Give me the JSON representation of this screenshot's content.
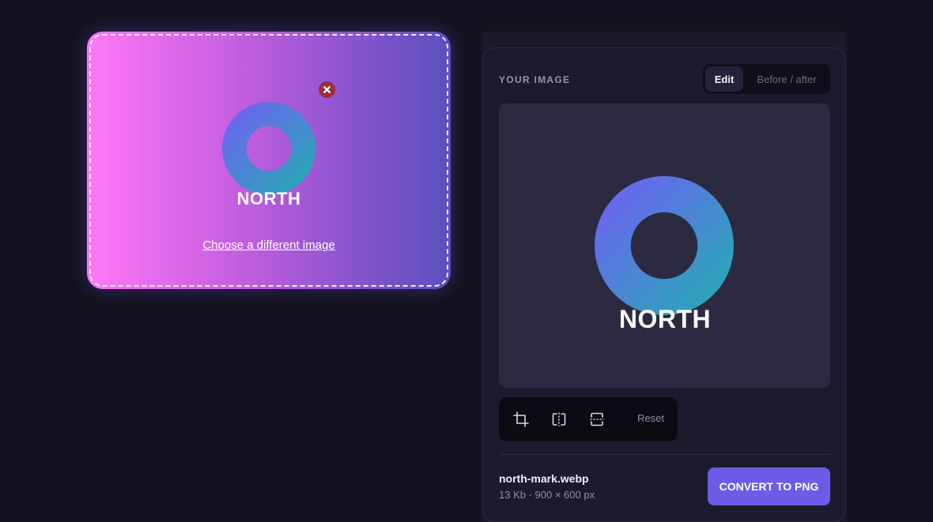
{
  "theme": {
    "accent": "#6c5ce7",
    "background": "#14131f",
    "remove_color": "#9b2f3a"
  },
  "dropzone": {
    "logo_text": "NORTH",
    "choose_link": "Choose a different image",
    "remove_icon": "close-icon"
  },
  "panel": {
    "title": "YOUR IMAGE",
    "tabs": [
      {
        "label": "Edit",
        "active": true
      },
      {
        "label": "Before / after",
        "active": false
      }
    ],
    "preview": {
      "logo_text": "NORTH"
    },
    "tools": [
      {
        "icon": "crop-icon"
      },
      {
        "icon": "flip-horizontal-icon"
      },
      {
        "icon": "flip-vertical-icon"
      }
    ],
    "reset_label": "Reset",
    "file": {
      "name": "north-mark.webp",
      "meta": "13 Kb · 900 × 600 px"
    },
    "convert_label": "CONVERT TO PNG"
  }
}
